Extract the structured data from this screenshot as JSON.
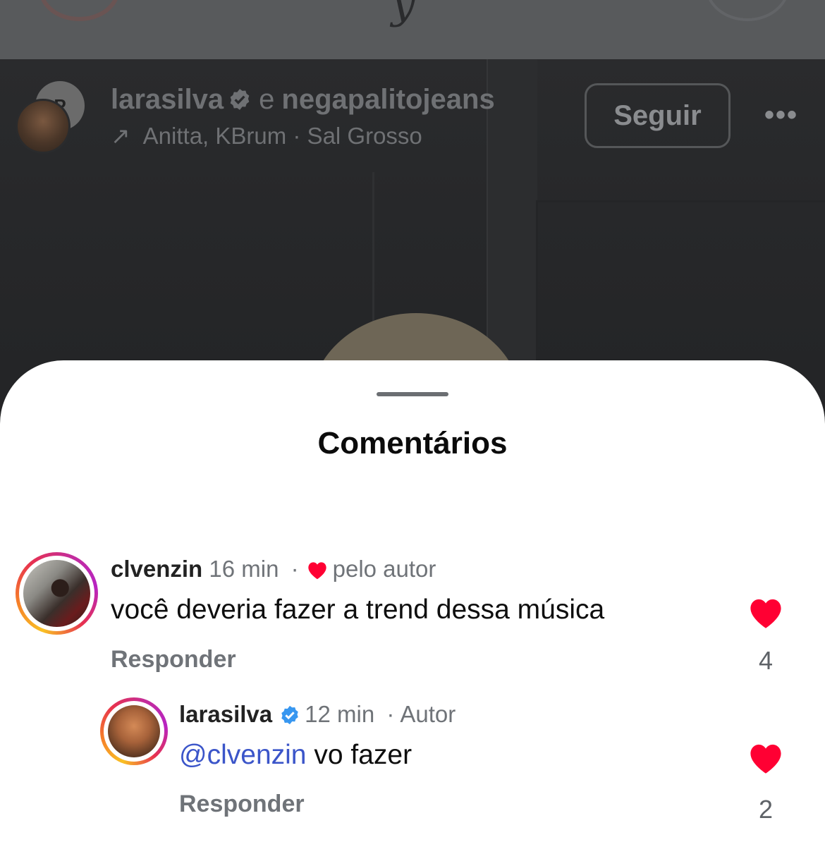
{
  "post_header": {
    "author": "larasilva",
    "connector": "e",
    "collaborator": "negapalitojeans",
    "collab_avatar_letter": "P",
    "audio_arrow": "↗",
    "audio": "Anitta, KBrum · Sal Grosso",
    "follow_label": "Seguir",
    "more_label": "•••"
  },
  "comments_sheet": {
    "title": "Comentários",
    "comments": [
      {
        "username": "clvenzin",
        "time": "16 min",
        "separator": "·",
        "liked_by_author": "pelo autor",
        "text": "você deveria fazer a trend dessa música",
        "reply_label": "Responder",
        "likes": "4"
      },
      {
        "username": "larasilva",
        "time": "12 min",
        "separator": "·",
        "badge": "Autor",
        "mention": "@clvenzin",
        "text": " vo fazer",
        "reply_label": "Responder",
        "likes": "2"
      }
    ]
  },
  "colors": {
    "heart": "#ff0033",
    "verified": "#3897f0",
    "mention": "#3b55c9"
  }
}
